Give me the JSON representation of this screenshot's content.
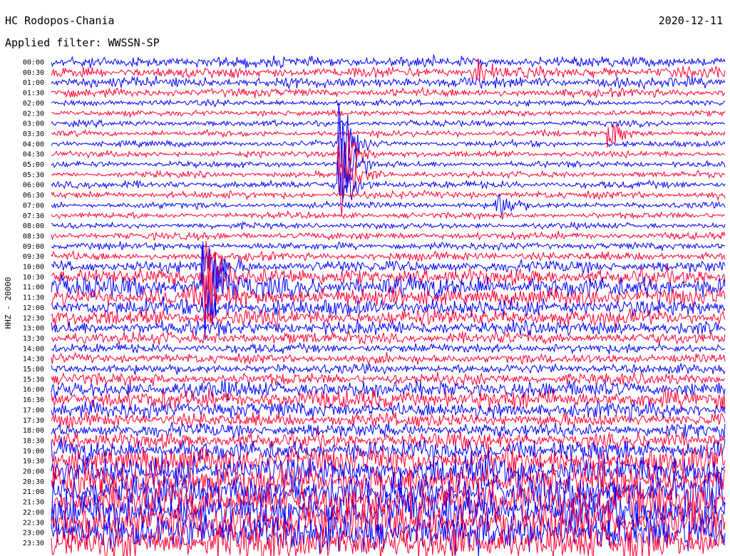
{
  "header": {
    "station": "HC Rodopos-Chania",
    "date": "2020-12-11",
    "filter_label": "Applied filter: WWSSN-SP"
  },
  "chart_data": {
    "type": "line",
    "title": "HC Rodopos-Chania",
    "ylabel": "HHZ - 20000",
    "colors": [
      "#0000ff",
      "#ff0033"
    ],
    "rows": [
      "00:00",
      "00:30",
      "01:00",
      "01:30",
      "02:00",
      "02:30",
      "03:00",
      "03:30",
      "04:00",
      "04:30",
      "05:00",
      "05:30",
      "06:00",
      "06:30",
      "07:00",
      "07:30",
      "08:00",
      "08:30",
      "09:00",
      "09:30",
      "10:00",
      "10:30",
      "11:00",
      "11:30",
      "12:00",
      "12:30",
      "13:00",
      "13:30",
      "14:00",
      "14:30",
      "15:00",
      "15:30",
      "16:00",
      "16:30",
      "17:00",
      "17:30",
      "18:00",
      "18:30",
      "19:00",
      "19:30",
      "20:00",
      "20:30",
      "21:00",
      "21:30",
      "22:00",
      "22:30",
      "23:00",
      "23:30"
    ],
    "noise_levels": [
      4.5,
      4.5,
      4.5,
      3.5,
      2.5,
      2.5,
      2.5,
      2.5,
      2.5,
      2.5,
      2.5,
      2.5,
      3,
      3,
      2.5,
      2.5,
      2.5,
      3,
      3,
      3.5,
      5,
      7,
      9,
      8,
      7,
      7,
      6,
      5,
      4,
      4,
      4,
      5,
      7,
      8,
      7,
      6,
      6,
      7,
      9,
      12,
      13,
      14,
      15,
      16,
      17,
      17,
      16,
      15
    ],
    "events": [
      {
        "row": 10,
        "minute": 13,
        "amplitude": 60
      },
      {
        "row": 9,
        "minute": 13,
        "amplitude": 55
      },
      {
        "row": 8,
        "minute": 13,
        "amplitude": 40
      },
      {
        "row": 11,
        "minute": 13,
        "amplitude": 45
      },
      {
        "row": 12,
        "minute": 13,
        "amplitude": 35
      },
      {
        "row": 14,
        "minute": 20,
        "amplitude": 18
      },
      {
        "row": 22,
        "minute": 7,
        "amplitude": 70
      },
      {
        "row": 21,
        "minute": 7,
        "amplitude": 60
      },
      {
        "row": 20,
        "minute": 7,
        "amplitude": 40
      },
      {
        "row": 23,
        "minute": 7,
        "amplitude": 30
      },
      {
        "row": 24,
        "minute": 7,
        "amplitude": 22
      },
      {
        "row": 7,
        "minute": 25,
        "amplitude": 16
      },
      {
        "row": 1,
        "minute": 19,
        "amplitude": 12
      }
    ]
  }
}
